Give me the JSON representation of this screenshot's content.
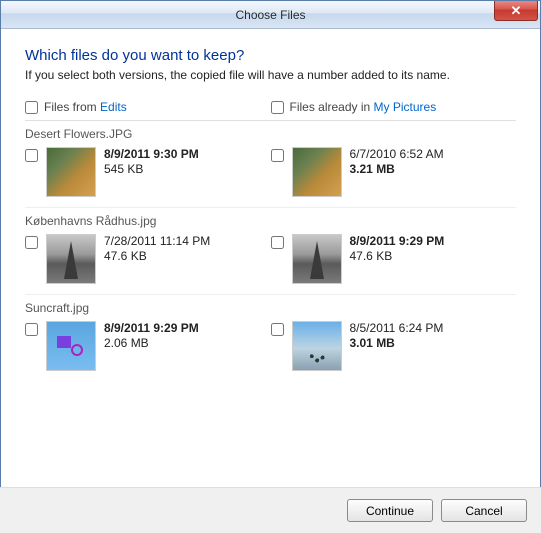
{
  "window": {
    "title": "Choose Files"
  },
  "heading": "Which files do you want to keep?",
  "subheading": "If you select both versions, the copied file will have a number added to its name.",
  "columns": {
    "left_prefix": "Files from ",
    "left_link": "Edits",
    "right_prefix": "Files already in ",
    "right_link": "My Pictures"
  },
  "groups": [
    {
      "name": "Desert Flowers.JPG",
      "left": {
        "date": "8/9/2011 9:30 PM",
        "size": "545 KB",
        "date_bold": true,
        "size_bold": false
      },
      "right": {
        "date": "6/7/2010 6:52 AM",
        "size": "3.21 MB",
        "date_bold": false,
        "size_bold": true
      }
    },
    {
      "name": "Københavns Rådhus.jpg",
      "left": {
        "date": "7/28/2011 11:14 PM",
        "size": "47.6 KB",
        "date_bold": false,
        "size_bold": false
      },
      "right": {
        "date": "8/9/2011 9:29 PM",
        "size": "47.6 KB",
        "date_bold": true,
        "size_bold": false
      }
    },
    {
      "name": "Suncraft.jpg",
      "left": {
        "date": "8/9/2011 9:29 PM",
        "size": "2.06 MB",
        "date_bold": true,
        "size_bold": false
      },
      "right": {
        "date": "8/5/2011 6:24 PM",
        "size": "3.01 MB",
        "date_bold": false,
        "size_bold": true
      }
    }
  ],
  "buttons": {
    "continue": "Continue",
    "cancel": "Cancel"
  }
}
